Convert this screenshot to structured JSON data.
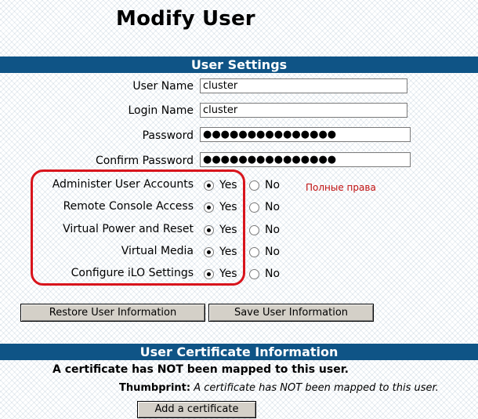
{
  "page": {
    "title": "Modify User"
  },
  "user_settings": {
    "header": "User Settings",
    "fields": [
      {
        "label": "User Name",
        "value": "cluster",
        "type": "text"
      },
      {
        "label": "Login Name",
        "value": "cluster",
        "type": "text"
      },
      {
        "label": "Password",
        "value": "●●●●●●●●●●●●●●●",
        "type": "password"
      },
      {
        "label": "Confirm Password",
        "value": "●●●●●●●●●●●●●●●",
        "type": "password"
      }
    ],
    "privileges": [
      {
        "label": "Administer User Accounts",
        "selected": "Yes"
      },
      {
        "label": "Remote Console Access",
        "selected": "Yes"
      },
      {
        "label": "Virtual Power and Reset",
        "selected": "Yes"
      },
      {
        "label": "Virtual Media",
        "selected": "Yes"
      },
      {
        "label": "Configure iLO Settings",
        "selected": "Yes"
      }
    ],
    "yes_label": "Yes",
    "no_label": "No",
    "annotation_note": "Полные права",
    "highlight_color": "#d8141c"
  },
  "buttons": {
    "restore": "Restore User Information",
    "save": "Save User Information",
    "add_certificate": "Add a certificate"
  },
  "certificate": {
    "header": "User Certificate Information",
    "status": "A certificate has NOT been mapped to this user.",
    "thumbprint_label": "Thumbprint:",
    "thumbprint_value": "A certificate has NOT been mapped to this user."
  },
  "colors": {
    "section_bar": "#0f5486",
    "button_face": "#d4d0c8"
  }
}
